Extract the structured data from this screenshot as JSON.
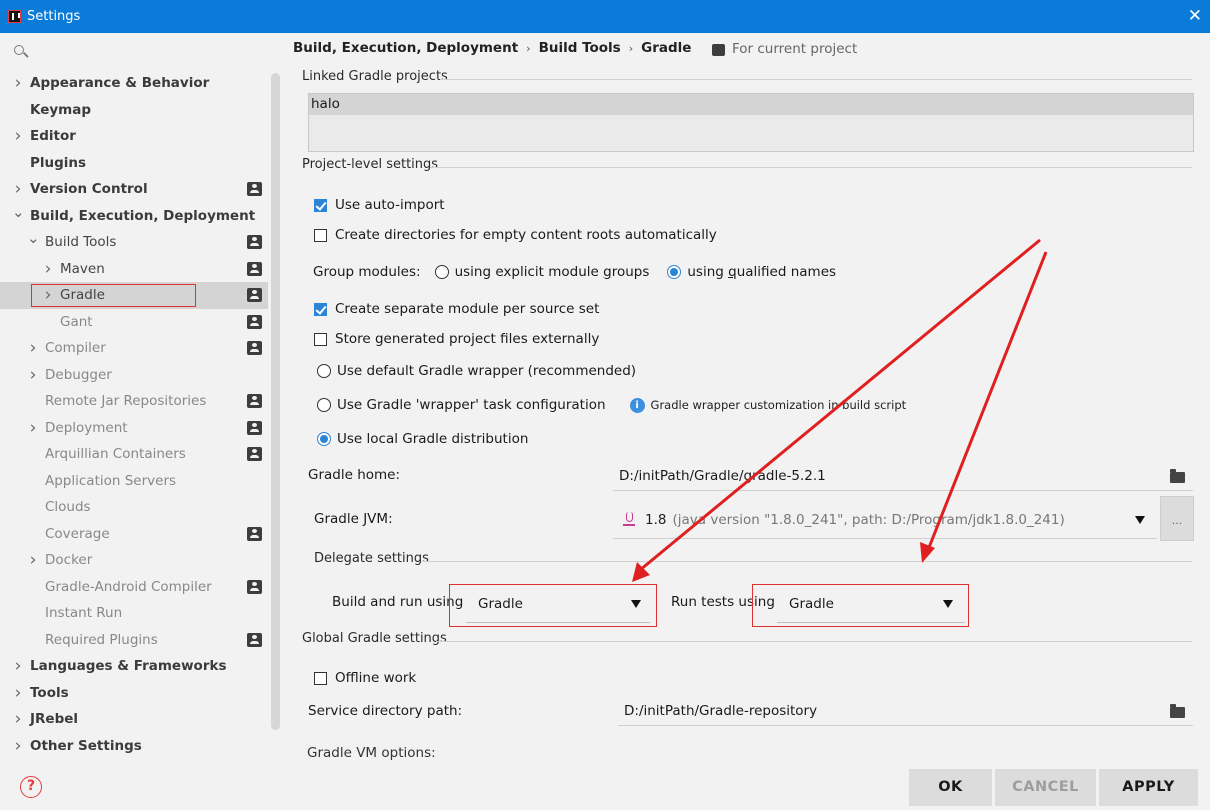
{
  "window": {
    "title": "Settings"
  },
  "tree": [
    {
      "label": "Appearance & Behavior",
      "level": 0,
      "arrow": "right",
      "style": "bold",
      "project": false
    },
    {
      "label": "Keymap",
      "level": 0,
      "arrow": "",
      "style": "bold",
      "project": false
    },
    {
      "label": "Editor",
      "level": 0,
      "arrow": "right",
      "style": "bold",
      "project": false
    },
    {
      "label": "Plugins",
      "level": 0,
      "arrow": "",
      "style": "bold",
      "project": false
    },
    {
      "label": "Version Control",
      "level": 0,
      "arrow": "right",
      "style": "bold",
      "project": true
    },
    {
      "label": "Build, Execution, Deployment",
      "level": 0,
      "arrow": "down",
      "style": "bold",
      "project": false
    },
    {
      "label": "Build Tools",
      "level": 1,
      "arrow": "down",
      "style": "plain",
      "project": true
    },
    {
      "label": "Maven",
      "level": 2,
      "arrow": "right",
      "style": "plain",
      "project": true
    },
    {
      "label": "Gradle",
      "level": 2,
      "arrow": "right",
      "style": "plain",
      "project": true,
      "selected": true
    },
    {
      "label": "Gant",
      "level": 2,
      "arrow": "",
      "style": "muted",
      "project": true
    },
    {
      "label": "Compiler",
      "level": 1,
      "arrow": "right",
      "style": "muted",
      "project": true
    },
    {
      "label": "Debugger",
      "level": 1,
      "arrow": "right",
      "style": "muted",
      "project": false
    },
    {
      "label": "Remote Jar Repositories",
      "level": 1,
      "arrow": "",
      "style": "muted",
      "project": true
    },
    {
      "label": "Deployment",
      "level": 1,
      "arrow": "right",
      "style": "muted",
      "project": true
    },
    {
      "label": "Arquillian Containers",
      "level": 1,
      "arrow": "",
      "style": "muted",
      "project": true
    },
    {
      "label": "Application Servers",
      "level": 1,
      "arrow": "",
      "style": "muted",
      "project": false
    },
    {
      "label": "Clouds",
      "level": 1,
      "arrow": "",
      "style": "muted",
      "project": false
    },
    {
      "label": "Coverage",
      "level": 1,
      "arrow": "",
      "style": "muted",
      "project": true
    },
    {
      "label": "Docker",
      "level": 1,
      "arrow": "right",
      "style": "muted",
      "project": false
    },
    {
      "label": "Gradle-Android Compiler",
      "level": 1,
      "arrow": "",
      "style": "muted",
      "project": true
    },
    {
      "label": "Instant Run",
      "level": 1,
      "arrow": "",
      "style": "muted",
      "project": false
    },
    {
      "label": "Required Plugins",
      "level": 1,
      "arrow": "",
      "style": "muted",
      "project": true
    },
    {
      "label": "Languages & Frameworks",
      "level": 0,
      "arrow": "right",
      "style": "bold",
      "project": false
    },
    {
      "label": "Tools",
      "level": 0,
      "arrow": "right",
      "style": "bold",
      "project": false
    },
    {
      "label": "JRebel",
      "level": 0,
      "arrow": "right",
      "style": "bold",
      "project": false
    },
    {
      "label": "Other Settings",
      "level": 0,
      "arrow": "right",
      "style": "bold",
      "project": false
    }
  ],
  "breadcrumb": [
    "Build, Execution, Deployment",
    "Build Tools",
    "Gradle"
  ],
  "scope": "For current project",
  "linked": {
    "title": "Linked Gradle projects",
    "items": [
      "halo"
    ]
  },
  "project_level": {
    "title": "Project-level settings",
    "auto_import": {
      "label": "Use auto-import",
      "checked": true
    },
    "create_dirs": {
      "label": "Create directories for empty content roots automatically",
      "checked": false
    },
    "group_modules": {
      "label": "Group modules:",
      "option1_pre": "using explicit module ",
      "option1_u": "g",
      "option1_post": "roups",
      "option2_pre": "using ",
      "option2_u": "q",
      "option2_post": "ualified names",
      "selected": 2
    },
    "separate_module": {
      "label": "Create separate module per source set",
      "checked": true
    },
    "store_externally": {
      "label": "Store generated project files externally",
      "checked": false
    },
    "wrapper_default": "Use default Gradle wrapper (recommended)",
    "wrapper_task": "Use Gradle 'wrapper' task configuration",
    "wrapper_info": "Gradle wrapper customization in build script",
    "local_dist": "Use local Gradle distribution",
    "selected_distribution": 3,
    "gradle_home_label": "Gradle home:",
    "gradle_home": "D:/initPath/Gradle/gradle-5.2.1",
    "gradle_jvm_label": "Gradle JVM:",
    "gradle_jvm_version": "1.8",
    "gradle_jvm_detail": "(java version \"1.8.0_241\", path: D:/Program/jdk1.8.0_241)"
  },
  "delegate": {
    "title": "Delegate settings",
    "build_run_label": "Build and run using",
    "build_run_value": "Gradle",
    "run_tests_label": "Run tests using",
    "run_tests_value": "Gradle"
  },
  "global": {
    "title": "Global Gradle settings",
    "offline": {
      "label": "Offline work",
      "checked": false
    },
    "service_dir_label": "Service directory path:",
    "service_dir": "D:/initPath/Gradle-repository",
    "vm_options_label": "Gradle VM options:"
  },
  "buttons": {
    "ok": "OK",
    "cancel": "CANCEL",
    "apply": "APPLY"
  },
  "colors": {
    "titlebar": "#0a7bd8",
    "accent": "#2c84d6",
    "annotation": "#e03030"
  }
}
